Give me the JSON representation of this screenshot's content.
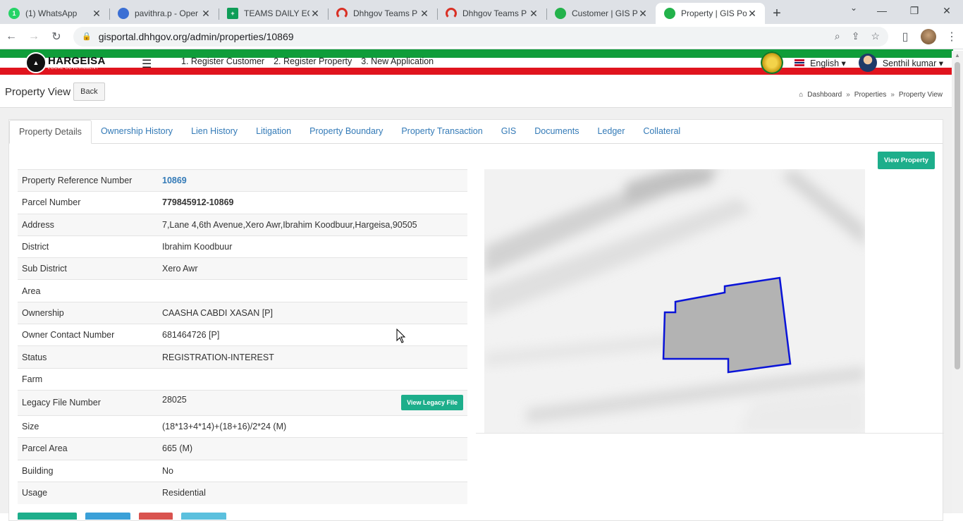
{
  "browser": {
    "tabs": [
      {
        "title": "(1) WhatsApp",
        "fav": "1",
        "color": "#25d366"
      },
      {
        "title": "pavithra.p - Oper",
        "fav": "",
        "color": "#3b6fd4"
      },
      {
        "title": "TEAMS DAILY EO",
        "fav": "+",
        "color": "#0f9d58"
      },
      {
        "title": "Dhhgov Teams P",
        "fav": "",
        "color": "#d93025"
      },
      {
        "title": "Dhhgov Teams P",
        "fav": "",
        "color": "#d93025"
      },
      {
        "title": "Customer | GIS P",
        "fav": "",
        "color": "#23b24b"
      },
      {
        "title": "Property | GIS Po",
        "fav": "",
        "color": "#23b24b"
      }
    ],
    "url": "gisportal.dhhgov.org/admin/properties/10869"
  },
  "header": {
    "logo_title": "HARGEISA",
    "logo_subtitle": "LOCAL GOVERNMENT",
    "nav": [
      "1. Register Customer",
      "2. Register Property",
      "3. New Application"
    ],
    "language": "English",
    "user": "Senthil kumar"
  },
  "page": {
    "title": "Property View",
    "back_label": "Back",
    "breadcrumbs": [
      "Dashboard",
      "Properties",
      "Property View"
    ]
  },
  "tabs": [
    "Property Details",
    "Ownership History",
    "Lien History",
    "Litigation",
    "Property Boundary",
    "Property Transaction",
    "GIS",
    "Documents",
    "Ledger",
    "Collateral"
  ],
  "view_property_label": "View Property",
  "legacy_btn_label": "View Legacy File",
  "details": [
    {
      "label": "Property Reference Number",
      "value": "10869"
    },
    {
      "label": "Parcel Number",
      "value": "779845912-10869"
    },
    {
      "label": "Address",
      "value": "7,Lane 4,6th Avenue,Xero Awr,Ibrahim Koodbuur,Hargeisa,90505"
    },
    {
      "label": "District",
      "value": "Ibrahim Koodbuur"
    },
    {
      "label": "Sub District",
      "value": "Xero Awr"
    },
    {
      "label": "Area",
      "value": ""
    },
    {
      "label": "Ownership",
      "value": "CAASHA CABDI XASAN [P]"
    },
    {
      "label": "Owner Contact Number",
      "value": "681464726 [P]"
    },
    {
      "label": "Status",
      "value": "REGISTRATION-INTEREST"
    },
    {
      "label": "Farm",
      "value": ""
    },
    {
      "label": "Legacy File Number",
      "value": "28025"
    },
    {
      "label": "Size",
      "value": "(18*13+4*14)+(18+16)/2*24 (M)"
    },
    {
      "label": "Parcel Area",
      "value": "665 (M)"
    },
    {
      "label": "Building",
      "value": "No"
    },
    {
      "label": "Usage",
      "value": "Residential"
    }
  ],
  "colors": {
    "accent": "#1dae8b",
    "link": "#337ab7",
    "parcel_fill": "#b3b3b3",
    "parcel_stroke": "#0a14d8"
  }
}
